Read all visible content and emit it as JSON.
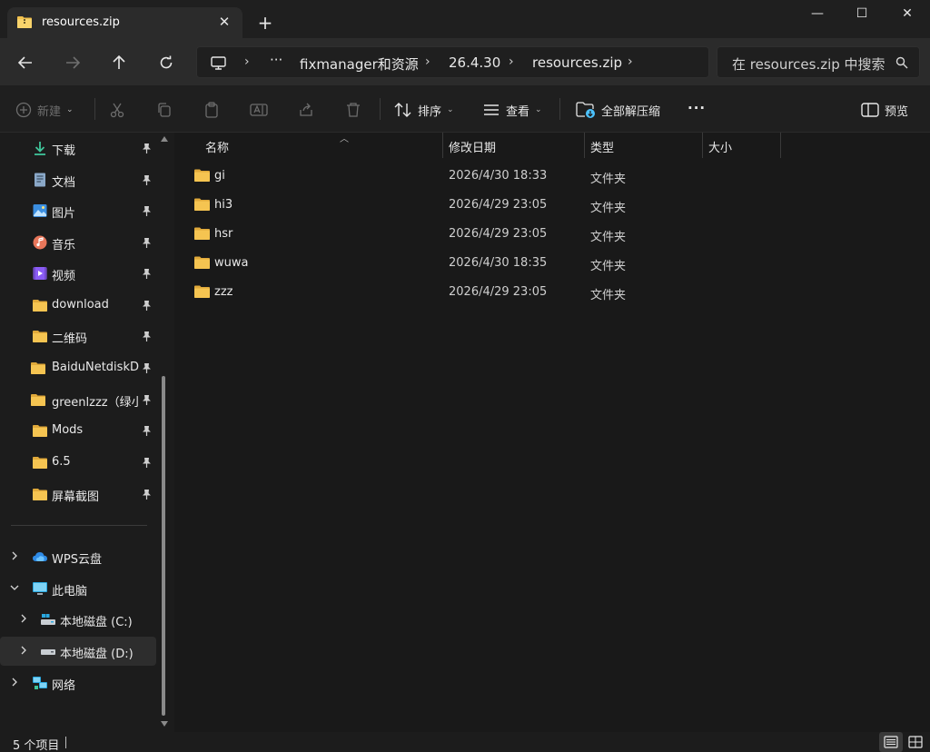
{
  "window": {
    "tab_title": "resources.zip",
    "new_tab_label": "+",
    "minimize_label": "—",
    "maximize_label": "☐",
    "close_label": "✕"
  },
  "address_bar": {
    "breadcrumbs": [
      "fixmanager和资源",
      "26.4.30",
      "resources.zip"
    ],
    "overflow_label": "···",
    "search_placeholder": "在 resources.zip 中搜索"
  },
  "command_bar": {
    "new_label": "新建",
    "sort_label": "排序",
    "view_label": "查看",
    "extract_all_label": "全部解压缩",
    "more_label": "···",
    "preview_label": "预览"
  },
  "sidebar": {
    "quick_access": [
      {
        "label": "下载",
        "icon": "download-icon"
      },
      {
        "label": "文档",
        "icon": "document-icon"
      },
      {
        "label": "图片",
        "icon": "picture-icon"
      },
      {
        "label": "音乐",
        "icon": "music-icon"
      },
      {
        "label": "视频",
        "icon": "video-icon"
      },
      {
        "label": "download",
        "icon": "folder-icon"
      },
      {
        "label": "二维码",
        "icon": "folder-icon"
      },
      {
        "label": "BaiduNetdiskDownload",
        "icon": "folder-icon"
      },
      {
        "label": "greenlzzz（绿小",
        "icon": "folder-icon"
      },
      {
        "label": "Mods",
        "icon": "folder-icon"
      },
      {
        "label": "6.5",
        "icon": "folder-icon"
      },
      {
        "label": "屏幕截图",
        "icon": "folder-icon"
      }
    ],
    "tree": [
      {
        "label": "WPS云盘",
        "icon": "cloud-icon"
      },
      {
        "label": "此电脑",
        "icon": "computer-icon"
      },
      {
        "label": "本地磁盘 (C:)",
        "icon": "drive-icon"
      },
      {
        "label": "本地磁盘 (D:)",
        "icon": "drive-icon"
      },
      {
        "label": "网络",
        "icon": "network-icon"
      }
    ]
  },
  "file_list": {
    "columns": [
      "名称",
      "修改日期",
      "类型",
      "大小"
    ],
    "rows": [
      {
        "name": "gi",
        "date": "2026/4/30 18:33",
        "type": "文件夹"
      },
      {
        "name": "hi3",
        "date": "2026/4/29 23:05",
        "type": "文件夹"
      },
      {
        "name": "hsr",
        "date": "2026/4/29 23:05",
        "type": "文件夹"
      },
      {
        "name": "wuwa",
        "date": "2026/4/30 18:35",
        "type": "文件夹"
      },
      {
        "name": "zzz",
        "date": "2026/4/29 23:05",
        "type": "文件夹"
      }
    ]
  },
  "status_bar": {
    "item_count": "5 个项目"
  },
  "colors": {
    "folder": "#f2c14e",
    "accent": "#4cc2ff",
    "background": "#191919"
  }
}
